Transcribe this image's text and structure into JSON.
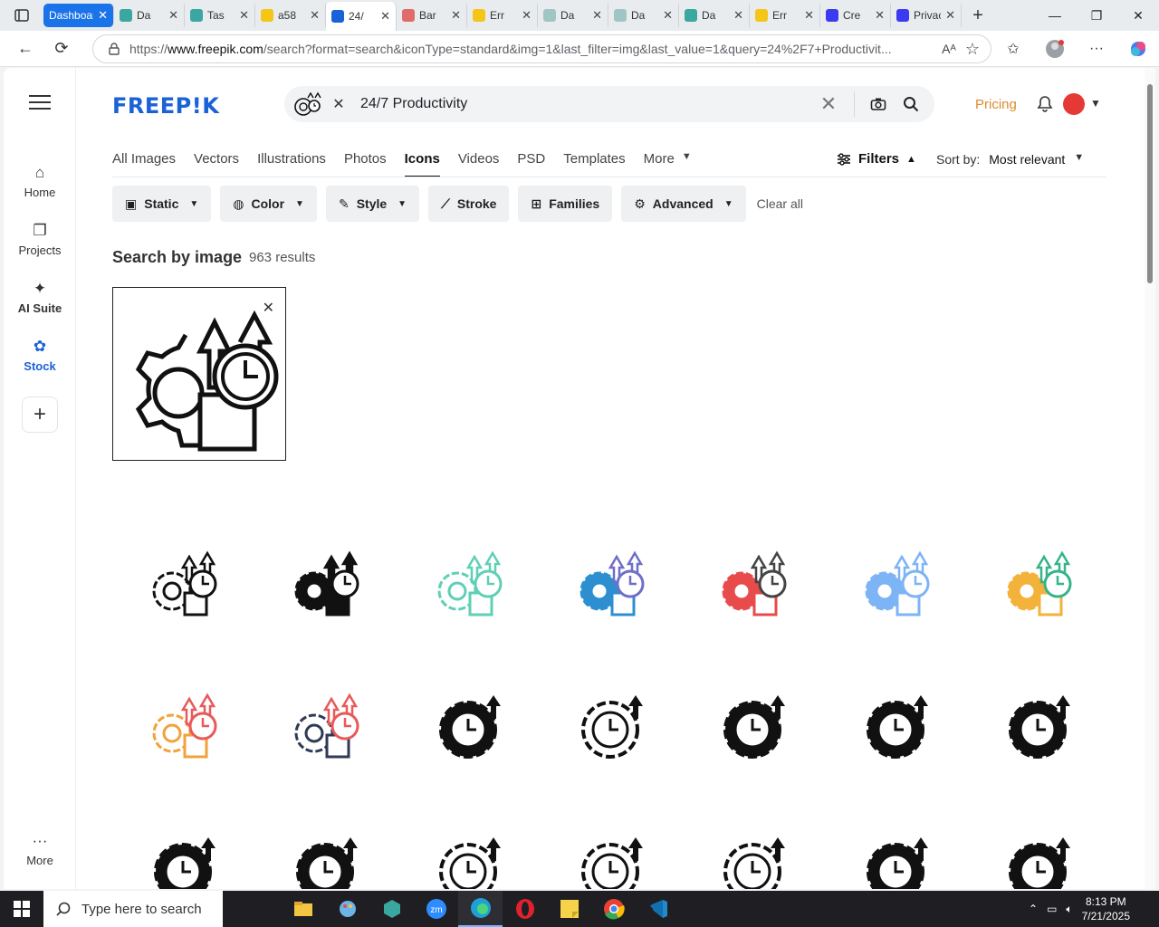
{
  "browser": {
    "tabs": [
      {
        "label": "Dashboar",
        "color": "#1a73e8",
        "kind": "dash"
      },
      {
        "label": "Da",
        "color": "#3aa7a0"
      },
      {
        "label": "Tas",
        "color": "#3aa7a0"
      },
      {
        "label": "a58",
        "color": "#f5c518"
      },
      {
        "label": "24/",
        "color": "#1a62d6",
        "kind": "active"
      },
      {
        "label": "Bar",
        "color": "#e06b6b"
      },
      {
        "label": "Err",
        "color": "#f5c518"
      },
      {
        "label": "Da",
        "color": "#9fc6c4"
      },
      {
        "label": "Da",
        "color": "#9fc6c4"
      },
      {
        "label": "Da",
        "color": "#3aa7a0"
      },
      {
        "label": "Err",
        "color": "#f5c518"
      },
      {
        "label": "Cre",
        "color": "#3a3af0"
      },
      {
        "label": "Privacy",
        "color": "#3a3af0"
      }
    ],
    "url_prefix": "https://",
    "url_host": "www.freepik.com",
    "url_rest": "/search?format=search&iconType=standard&img=1&last_filter=img&last_value=1&query=24%2F7+Productivit..."
  },
  "sidebar": {
    "items": [
      {
        "label": "Home",
        "icon": "home-icon"
      },
      {
        "label": "Projects",
        "icon": "projects-icon"
      },
      {
        "label": "AI Suite",
        "icon": "sparkle-icon"
      },
      {
        "label": "Stock",
        "icon": "stock-icon"
      }
    ],
    "more_label": "More"
  },
  "header": {
    "logo": "FREEP!K",
    "search_query": "24/7 Productivity",
    "pricing": "Pricing"
  },
  "categories": [
    "All Images",
    "Vectors",
    "Illustrations",
    "Photos",
    "Icons",
    "Videos",
    "PSD",
    "Templates",
    "More"
  ],
  "active_category": "Icons",
  "filters": {
    "filters_label": "Filters",
    "sort_label": "Sort by:",
    "sort_value": "Most relevant",
    "chips": [
      "Static",
      "Color",
      "Style",
      "Stroke",
      "Families",
      "Advanced"
    ],
    "clear_all": "Clear all"
  },
  "results": {
    "title": "Search by image",
    "count": "963 results"
  },
  "icons": [
    {
      "style": "outline",
      "c1": "#111111",
      "c2": "#111111"
    },
    {
      "style": "solid",
      "c1": "#111111",
      "c2": "#111111"
    },
    {
      "style": "outline",
      "c1": "#5fcfb6",
      "c2": "#5fcfb6"
    },
    {
      "style": "duo",
      "c1": "#2d8fd0",
      "c2": "#6f6fc9"
    },
    {
      "style": "duo",
      "c1": "#e84b4b",
      "c2": "#444444"
    },
    {
      "style": "duo",
      "c1": "#7db4f5",
      "c2": "#7db4f5"
    },
    {
      "style": "color",
      "c1": "#f3b23a",
      "c2": "#36b38b"
    },
    {
      "style": "outline",
      "c1": "#f3a23a",
      "c2": "#e85a5a"
    },
    {
      "style": "outline",
      "c1": "#2f3a57",
      "c2": "#e85a5a"
    },
    {
      "style": "clock-solid",
      "c1": "#111111",
      "c2": "#111111"
    },
    {
      "style": "clock-outline",
      "c1": "#111111",
      "c2": "#111111"
    },
    {
      "style": "clock-solid",
      "c1": "#111111",
      "c2": "#111111"
    },
    {
      "style": "clock-solid",
      "c1": "#111111",
      "c2": "#111111"
    },
    {
      "style": "clock-solid",
      "c1": "#111111",
      "c2": "#111111"
    },
    {
      "style": "clock-solid",
      "c1": "#111111",
      "c2": "#111111"
    },
    {
      "style": "clock-solid",
      "c1": "#111111",
      "c2": "#111111"
    },
    {
      "style": "clock-outline",
      "c1": "#111111",
      "c2": "#111111"
    },
    {
      "style": "clock-outline",
      "c1": "#111111",
      "c2": "#111111"
    },
    {
      "style": "clock-outline",
      "c1": "#111111",
      "c2": "#111111"
    },
    {
      "style": "clock-solid",
      "c1": "#111111",
      "c2": "#111111"
    },
    {
      "style": "clock-solid",
      "c1": "#111111",
      "c2": "#111111"
    }
  ],
  "taskbar": {
    "search_placeholder": "Type here to search",
    "time": "8:13 PM",
    "date": "7/21/2025"
  }
}
